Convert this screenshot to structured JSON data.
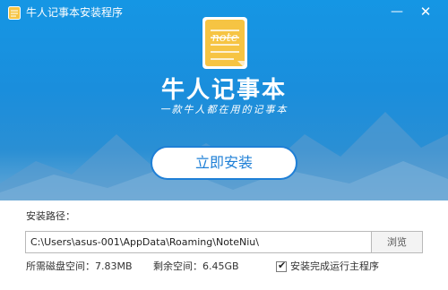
{
  "window": {
    "title": "牛人记事本安装程序",
    "minimize_glyph": "—",
    "close_glyph": "✕"
  },
  "hero": {
    "logo_icon": "notebook-icon",
    "logo_text": "note",
    "product_name": "牛人记事本",
    "slogan": "一款牛人都在用的记事本"
  },
  "install": {
    "button_label": "立即安装"
  },
  "path": {
    "label": "安装路径：",
    "value": "C:\\Users\\asus-001\\AppData\\Roaming\\NoteNiu\\",
    "browse_label": "浏览"
  },
  "disk": {
    "required": "所需磁盘空间：7.83MB",
    "free": "剩余空间：6.45GB"
  },
  "options": {
    "run_after_install_label": "安装完成运行主程序",
    "run_after_install_checked": true
  },
  "colors": {
    "header_blue": "#1596e4",
    "accent_blue": "#1e7fd6",
    "logo_yellow": "#f6c443"
  }
}
